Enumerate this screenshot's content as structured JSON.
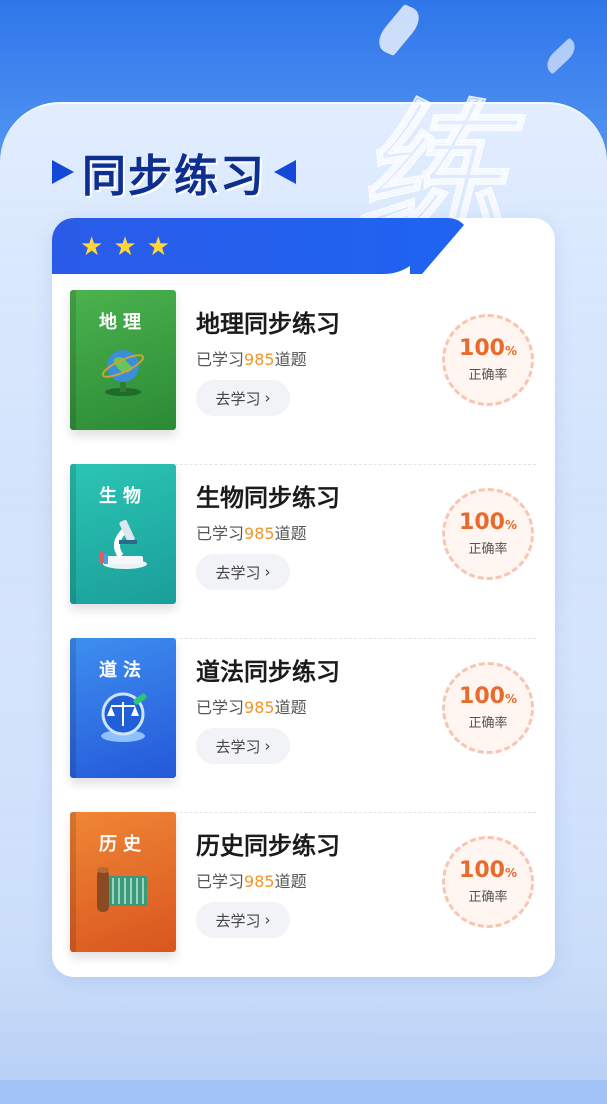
{
  "header": {
    "title": "同步练习",
    "bg_char": "练"
  },
  "colors": {
    "primary": "#1f63f0",
    "accent": "#f2952b",
    "rate": "#e86a2c",
    "star": "#ffd53a"
  },
  "stars_icon": "star-icon",
  "items": [
    {
      "subject": "地理",
      "title": "地理同步练习",
      "learned_prefix": "已学习",
      "learned_count": "985",
      "learned_suffix": "道题",
      "button": "去学习",
      "rate_value": "100",
      "rate_unit": "%",
      "rate_label": "正确率",
      "icon": "globe-icon"
    },
    {
      "subject": "生物",
      "title": "生物同步练习",
      "learned_prefix": "已学习",
      "learned_count": "985",
      "learned_suffix": "道题",
      "button": "去学习",
      "rate_value": "100",
      "rate_unit": "%",
      "rate_label": "正确率",
      "icon": "microscope-icon"
    },
    {
      "subject": "道法",
      "title": "道法同步练习",
      "learned_prefix": "已学习",
      "learned_count": "985",
      "learned_suffix": "道题",
      "button": "去学习",
      "rate_value": "100",
      "rate_unit": "%",
      "rate_label": "正确率",
      "icon": "scales-icon"
    },
    {
      "subject": "历史",
      "title": "历史同步练习",
      "learned_prefix": "已学习",
      "learned_count": "985",
      "learned_suffix": "道题",
      "button": "去学习",
      "rate_value": "100",
      "rate_unit": "%",
      "rate_label": "正确率",
      "icon": "scroll-icon"
    }
  ]
}
